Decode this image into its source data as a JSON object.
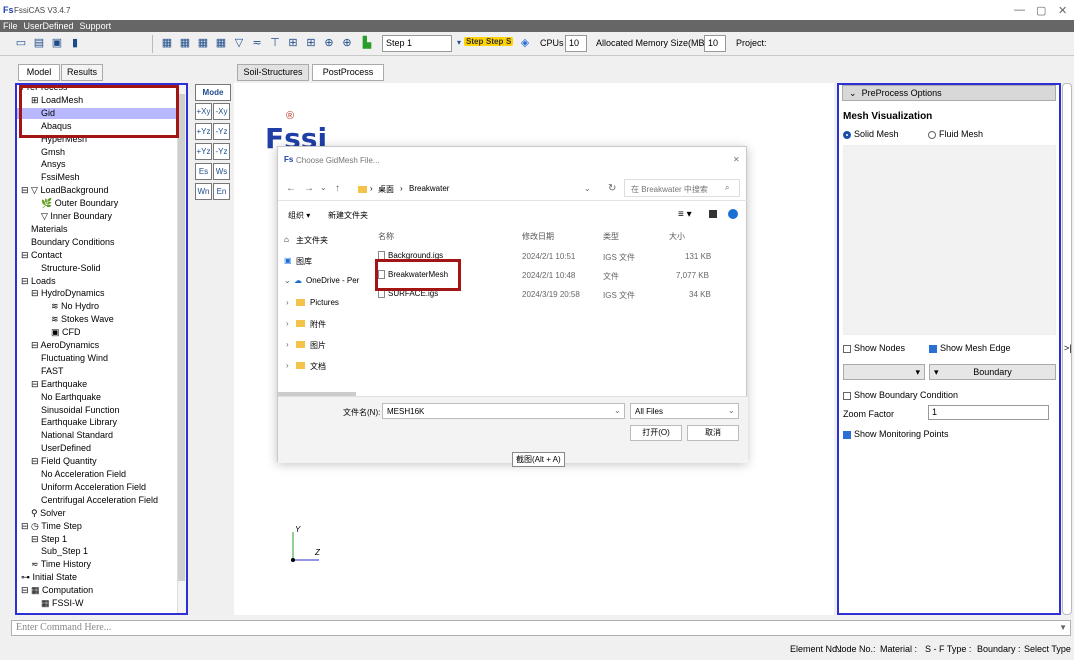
{
  "window": {
    "title": "FssiCAS V3.4.7",
    "app_icon": "Fs",
    "minimize": "—",
    "restore": "▢",
    "close": "✕"
  },
  "menu": {
    "items": [
      "File",
      "UserDefined",
      "Support"
    ]
  },
  "toolbar": {
    "step_value": "Step 1",
    "step_badges": [
      "Step",
      "Step",
      "S"
    ],
    "cpus_label": "CPUs",
    "cpus_value": "10",
    "memory_label": "Allocated Memory Size(MB) :",
    "memory_value": "10",
    "project_label": "Project:"
  },
  "left_tabs": {
    "model": "Model",
    "results": "Results"
  },
  "center_tabs": {
    "soil_structures": "Soil-Structures",
    "post_process": "PostProcess"
  },
  "tree": {
    "items": [
      {
        "label": "PreProcess",
        "indent": 0
      },
      {
        "label": "⊞ LoadMesh",
        "indent": 1
      },
      {
        "label": "Gid",
        "indent": 2,
        "selected": true
      },
      {
        "label": "Abaqus",
        "indent": 2
      },
      {
        "label": "HyperMesh",
        "indent": 2
      },
      {
        "label": "Gmsh",
        "indent": 2
      },
      {
        "label": "Ansys",
        "indent": 2
      },
      {
        "label": "FssiMesh",
        "indent": 2
      },
      {
        "label": "⊟ ▽ LoadBackground",
        "indent": 0
      },
      {
        "label": "🌿 Outer Boundary",
        "indent": 2
      },
      {
        "label": "▽ Inner Boundary",
        "indent": 2
      },
      {
        "label": "Materials",
        "indent": 1
      },
      {
        "label": "Boundary Conditions",
        "indent": 1
      },
      {
        "label": "⊟ Contact",
        "indent": 0
      },
      {
        "label": "Structure-Solid",
        "indent": 2
      },
      {
        "label": "⊟ Loads",
        "indent": 0
      },
      {
        "label": "⊟ HydroDynamics",
        "indent": 1
      },
      {
        "label": "≋ No Hydro",
        "indent": 3
      },
      {
        "label": "≋ Stokes Wave",
        "indent": 3
      },
      {
        "label": "▣ CFD",
        "indent": 3
      },
      {
        "label": "⊟ AeroDynamics",
        "indent": 1
      },
      {
        "label": "Fluctuating Wind",
        "indent": 2
      },
      {
        "label": "FAST",
        "indent": 2
      },
      {
        "label": "⊟ Earthquake",
        "indent": 1
      },
      {
        "label": "No Earthquake",
        "indent": 2
      },
      {
        "label": "Sinusoidal Function",
        "indent": 2
      },
      {
        "label": "Earthquake Library",
        "indent": 2
      },
      {
        "label": "National Standard",
        "indent": 2
      },
      {
        "label": "UserDefined",
        "indent": 2
      },
      {
        "label": "⊟ Field Quantity",
        "indent": 1
      },
      {
        "label": "No Acceleration Field",
        "indent": 2
      },
      {
        "label": "Uniform Acceleration Field",
        "indent": 2
      },
      {
        "label": "Centrifugal Acceleration Field",
        "indent": 2
      },
      {
        "label": "⚲ Solver",
        "indent": 1
      },
      {
        "label": "⊟ ◷ Time Step",
        "indent": 0
      },
      {
        "label": "⊟ Step 1",
        "indent": 1
      },
      {
        "label": "Sub_Step 1",
        "indent": 2
      },
      {
        "label": "≂ Time History",
        "indent": 1
      },
      {
        "label": "⊶ Initial State",
        "indent": 0
      },
      {
        "label": "⊟ ▦ Computation",
        "indent": 0
      },
      {
        "label": "▦ FSSI-W",
        "indent": 2
      }
    ]
  },
  "mini_buttons": [
    "Mode",
    "+Xy",
    "-Xy",
    "+Yz",
    "-Yz",
    "+Yz",
    "-Yz",
    "Es",
    "Ws",
    "Wn",
    "En"
  ],
  "canvas": {
    "logo_main": "Fssi",
    "logo_mark": "®",
    "axis_y": "Y",
    "axis_x": "Z",
    "tooltip": "截图(Alt + A)"
  },
  "dialog": {
    "title": "Choose GidMesh File...",
    "close": "✕",
    "path": [
      "桌面",
      "Breakwater"
    ],
    "search_placeholder": "在 Breakwater 中搜索",
    "organize": "组织 ▾",
    "new_folder": "新建文件夹",
    "columns": [
      "名称",
      "修改日期",
      "类型",
      "大小"
    ],
    "nav": [
      "主文件夹",
      "图库",
      "OneDrive - Per",
      "Pictures",
      "附件",
      "图片",
      "文档"
    ],
    "files": [
      {
        "name": "Background.igs",
        "date": "2024/2/1 10:51",
        "type": "IGS 文件",
        "size": "131 KB"
      },
      {
        "name": "BreakwaterMesh",
        "date": "2024/2/1 10:48",
        "type": "文件",
        "size": "7,077 KB"
      },
      {
        "name": "SURFACE.igs",
        "date": "2024/3/19 20:58",
        "type": "IGS 文件",
        "size": "34 KB"
      }
    ],
    "filename_label": "文件名(N):",
    "filename_value": "MESH16K",
    "filter": "All Files",
    "open": "打开(O)",
    "cancel": "取消"
  },
  "right_panel": {
    "header": "PreProcess Options",
    "section": "Mesh Visualization",
    "solid_mesh": "Solid Mesh",
    "fluid_mesh": "Fluid Mesh",
    "show_nodes": "Show Nodes",
    "show_mesh_edge": "Show Mesh Edge",
    "boundary": "Boundary",
    "show_boundary": "Show Boundary Condition",
    "zoom_label": "Zoom Factor",
    "zoom_value": "1",
    "show_monitor": "Show Monitoring Points",
    "collapse": ">|"
  },
  "command": {
    "placeholder": "Enter Command Here..."
  },
  "status": {
    "items": [
      "Element No.:",
      "Node No.:",
      "Material :",
      "S - F Type :",
      "Boundary :",
      "Select Type :"
    ]
  }
}
